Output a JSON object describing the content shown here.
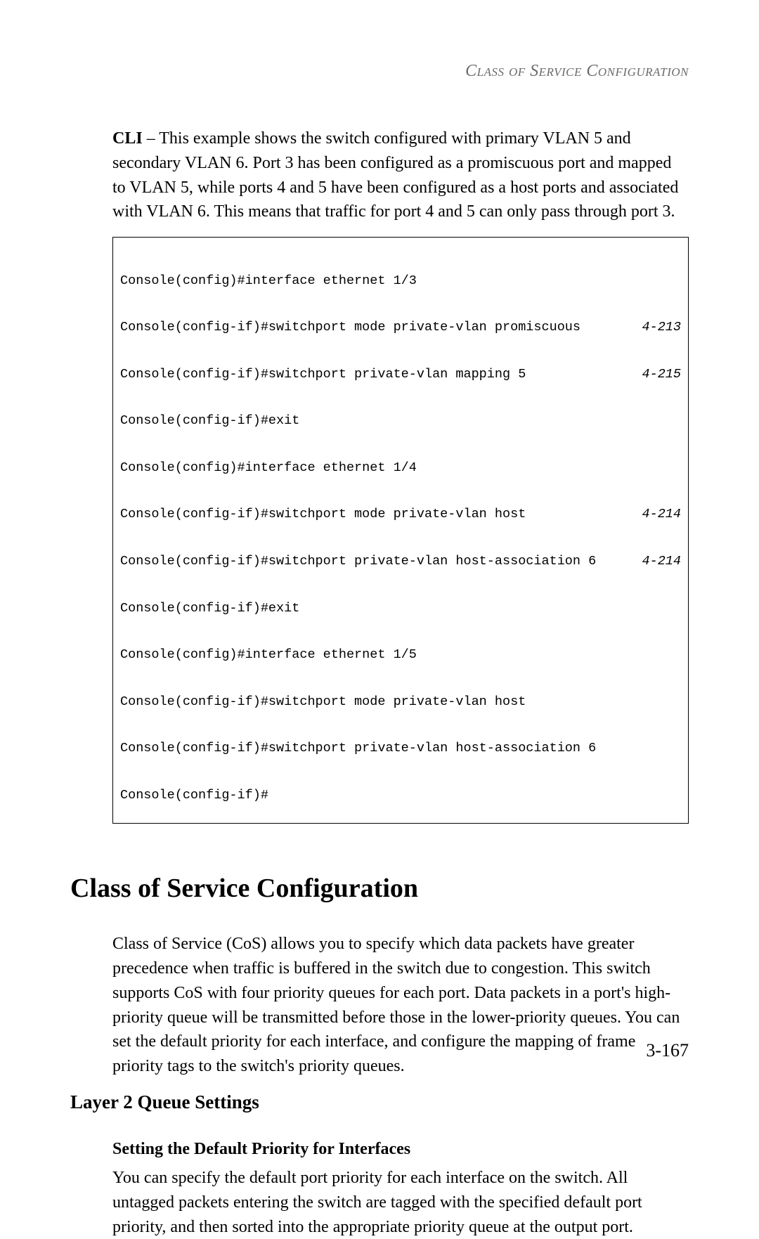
{
  "header": {
    "running_title": "Class of Service Configuration"
  },
  "intro": {
    "cli_label": "CLI",
    "paragraph": " – This example shows the switch configured with primary VLAN 5 and secondary VLAN 6. Port 3 has been configured as a promiscuous port and mapped to VLAN 5, while ports 4 and 5 have been configured as a host ports and associated with VLAN 6. This means that traffic for port 4 and 5 can only pass through port 3."
  },
  "code": {
    "lines": [
      {
        "text": "Console(config)#interface ethernet 1/3",
        "ref": ""
      },
      {
        "text": "Console(config-if)#switchport mode private-vlan promiscuous",
        "ref": "4-213"
      },
      {
        "text": "Console(config-if)#switchport private-vlan mapping 5",
        "ref": "4-215"
      },
      {
        "text": "Console(config-if)#exit",
        "ref": ""
      },
      {
        "text": "Console(config)#interface ethernet 1/4",
        "ref": ""
      },
      {
        "text": "Console(config-if)#switchport mode private-vlan host",
        "ref": "4-214"
      },
      {
        "text": "Console(config-if)#switchport private-vlan host-association 6",
        "ref": "4-214"
      },
      {
        "text": "Console(config-if)#exit",
        "ref": ""
      },
      {
        "text": "Console(config)#interface ethernet 1/5",
        "ref": ""
      },
      {
        "text": "Console(config-if)#switchport mode private-vlan host",
        "ref": ""
      },
      {
        "text": "Console(config-if)#switchport private-vlan host-association 6",
        "ref": ""
      },
      {
        "text": "Console(config-if)#",
        "ref": ""
      }
    ]
  },
  "section": {
    "title": "Class of Service Configuration",
    "paragraph": "Class of Service (CoS) allows you to specify which data packets have greater precedence when traffic is buffered in the switch due to congestion. This switch supports CoS with four priority queues for each port. Data packets in a port's high-priority queue will be transmitted before those in the lower-priority queues. You can set the default priority for each interface, and configure the mapping of frame priority tags to the switch's priority queues."
  },
  "subsection": {
    "title": "Layer 2 Queue Settings"
  },
  "subsubsection": {
    "title": "Setting the Default Priority for Interfaces",
    "paragraph": "You can specify the default port priority for each interface on the switch. All untagged packets entering the switch are tagged with the specified default port priority, and then sorted into the appropriate priority queue at the output port."
  },
  "page_number": "3-167"
}
